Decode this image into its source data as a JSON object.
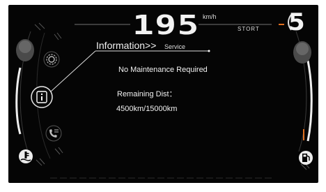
{
  "speed": {
    "value": "195",
    "unit": "km/h"
  },
  "drive_mode": "STORT",
  "gear": "5",
  "menu": {
    "title": "Information",
    "chevron": ">>",
    "subtitle": "Service"
  },
  "messages": {
    "status": "No Maintenance Required",
    "distance_label": "Remaining Dist：",
    "distance_value": "4500km/15000km"
  },
  "icons": {
    "settings": "gear-icon",
    "info": "info-icon",
    "phone": "phone-icon",
    "coolant": "coolant-temperature-icon",
    "fuel": "fuel-pump-icon"
  },
  "colors": {
    "background": "#050505",
    "text": "#f2f2f2",
    "accent": "#e07020",
    "highlight": "#ffffff"
  }
}
